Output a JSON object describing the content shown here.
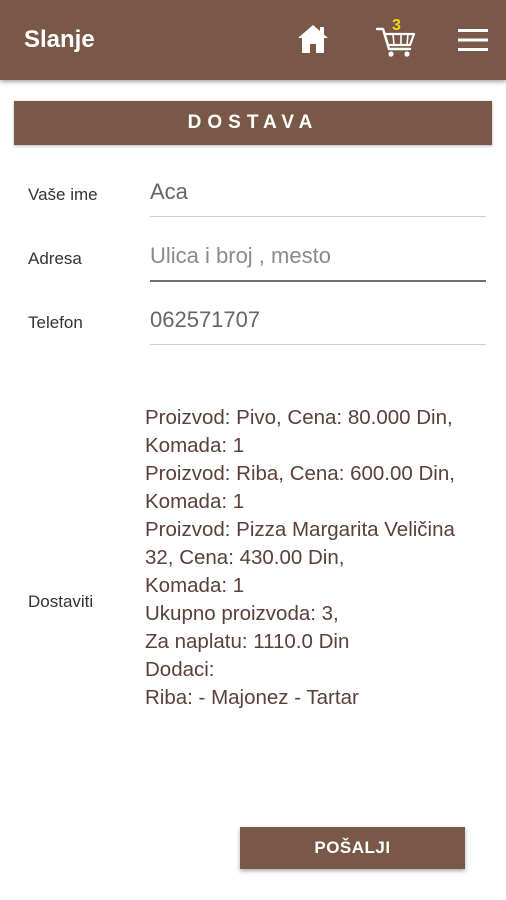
{
  "app": {
    "title": "Slanje",
    "cart_count": "3"
  },
  "icons": {
    "home": "home-icon",
    "cart": "cart-icon",
    "menu": "menu-icon"
  },
  "colors": {
    "brand": "#7a5848",
    "badge": "#f5d418",
    "summary_text": "#5a4038"
  },
  "section": {
    "title": "DOSTAVA"
  },
  "form": {
    "name_label": "Vaše ime",
    "name_value": "Aca",
    "address_label": "Adresa",
    "address_placeholder": "Ulica i broj , mesto",
    "phone_label": "Telefon",
    "phone_value": "062571707",
    "deliver_label": "Dostaviti"
  },
  "order_summary": "Proizvod: Pivo, Cena:  80.000 Din,\nKomada: 1\nProizvod: Riba, Cena:  600.00 Din,\nKomada: 1\nProizvod: Pizza Margarita Veličina 32, Cena:  430.00 Din,\nKomada: 1\nUkupno proizvoda: 3,\nZa naplatu: 1110.0 Din\nDodaci:\nRiba: - Majonez - Tartar",
  "actions": {
    "send_label": "POŠALJI"
  }
}
